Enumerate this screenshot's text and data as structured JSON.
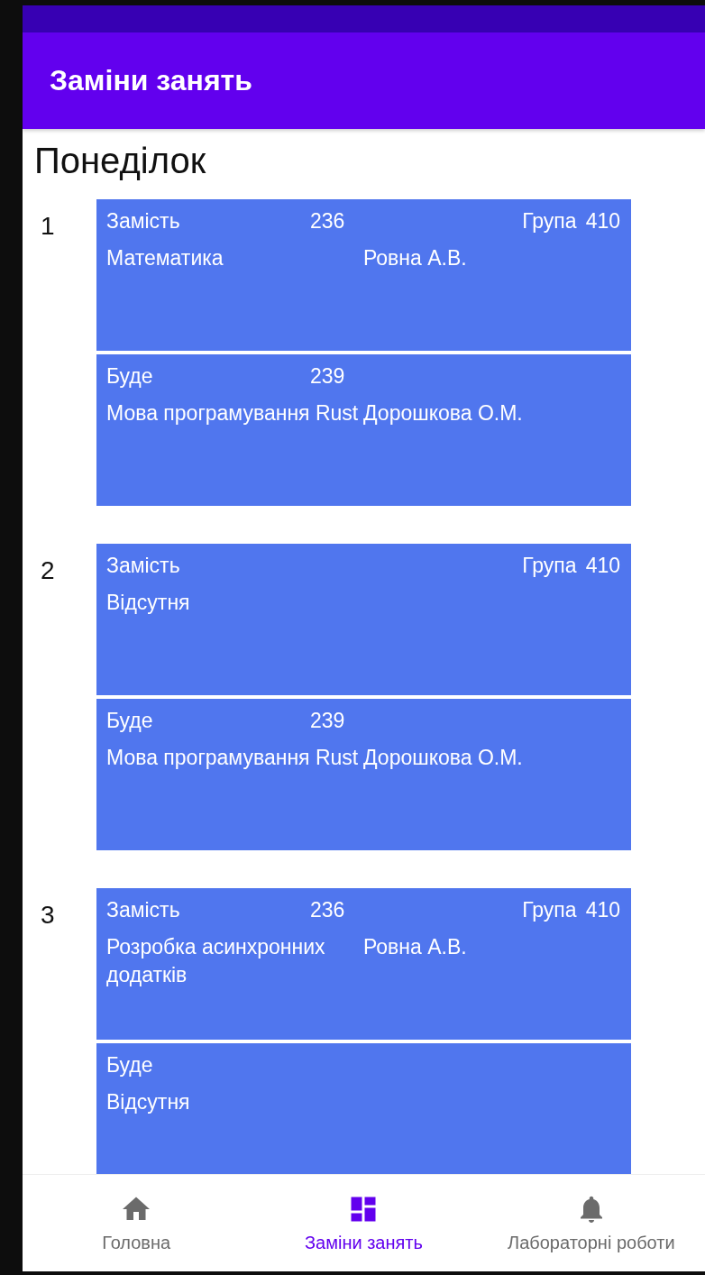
{
  "app_bar": {
    "title": "Заміни занять"
  },
  "day": {
    "title": "Понеділок",
    "lessons": [
      {
        "number": "1",
        "was": {
          "label": "Замість",
          "room": "236",
          "group_label": "Група",
          "group": "410",
          "subject": "Математика",
          "teacher": "Ровна А.В."
        },
        "now": {
          "label": "Буде",
          "room": "239",
          "subject": "Мова програмування Rust",
          "teacher": "Дорошкова О.М."
        }
      },
      {
        "number": "2",
        "was": {
          "label": "Замість",
          "group_label": "Група",
          "group": "410",
          "subject": "Відсутня"
        },
        "now": {
          "label": "Буде",
          "room": "239",
          "subject": "Мова програмування Rust",
          "teacher": "Дорошкова О.М."
        }
      },
      {
        "number": "3",
        "was": {
          "label": "Замість",
          "room": "236",
          "group_label": "Група",
          "group": "410",
          "subject": "Розробка асинхронних додатків",
          "teacher": "Ровна А.В."
        },
        "now": {
          "label": "Буде",
          "subject": "Відсутня"
        }
      }
    ]
  },
  "bottom_nav": [
    {
      "kind": "home",
      "label": "Головна",
      "selected": false
    },
    {
      "kind": "grid",
      "label": "Заміни занять",
      "selected": true
    },
    {
      "kind": "bell",
      "label": "Лабораторні роботи",
      "selected": false
    }
  ]
}
